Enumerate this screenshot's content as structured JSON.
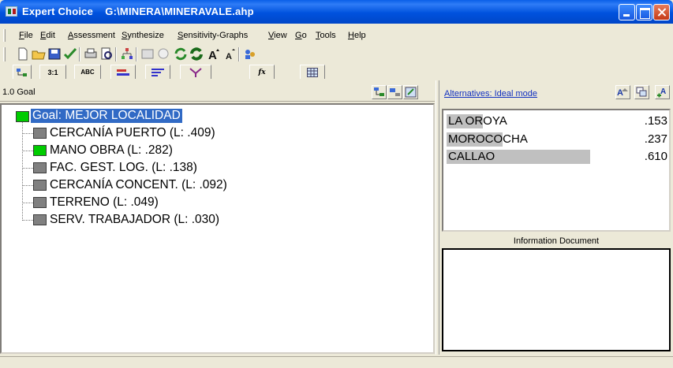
{
  "window": {
    "app_name": "Expert Choice",
    "file_path": "G:\\MINERA\\MINERAVALE.ahp"
  },
  "menu": [
    "File",
    "Edit",
    "Assessment",
    "Synthesize",
    "Sensitivity-Graphs",
    "View",
    "Go",
    "Tools",
    "Help"
  ],
  "tabs": [
    {
      "name": "tree-view-tab",
      "label": ""
    },
    {
      "name": "pairwise-numerical-tab",
      "label": "3:1"
    },
    {
      "name": "pairwise-verbal-tab",
      "label": "ABC"
    },
    {
      "name": "pairwise-graphical-tab",
      "label": ""
    },
    {
      "name": "rating-tab",
      "label": ""
    },
    {
      "name": "questionnaire-tab",
      "label": ""
    },
    {
      "name": "formula-tab",
      "label": "fx"
    },
    {
      "name": "data-grid-tab",
      "label": ""
    }
  ],
  "left_pane": {
    "node_id": "1.0 Goal"
  },
  "tree": {
    "goal": "Goal: MEJOR LOCALIDAD",
    "goal_color": "#00cc00",
    "nodes": [
      {
        "label": "CERCANÍA PUERTO (L: .409)",
        "color": "#808080"
      },
      {
        "label": "MANO OBRA (L: .282)",
        "color": "#00cc00"
      },
      {
        "label": "FAC. GEST. LOG. (L: .138)",
        "color": "#808080"
      },
      {
        "label": "CERCANÍA CONCENT. (L: .092)",
        "color": "#808080"
      },
      {
        "label": "TERRENO (L: .049)",
        "color": "#808080"
      },
      {
        "label": "SERV. TRABAJADOR (L: .030)",
        "color": "#808080"
      }
    ]
  },
  "right_pane": {
    "mode_link": "Alternatives: Ideal mode",
    "alternatives": [
      {
        "name": "LA OROYA",
        "value": ".153",
        "score": 0.153
      },
      {
        "name": "MOROCOCHA",
        "value": ".237",
        "score": 0.237
      },
      {
        "name": "CALLAO",
        "value": ".610",
        "score": 0.61
      }
    ],
    "info_label": "Information Document"
  },
  "colors": {
    "titlebar": "#0052de",
    "selection": "#316ac5",
    "bar": "#c0c0c0"
  }
}
